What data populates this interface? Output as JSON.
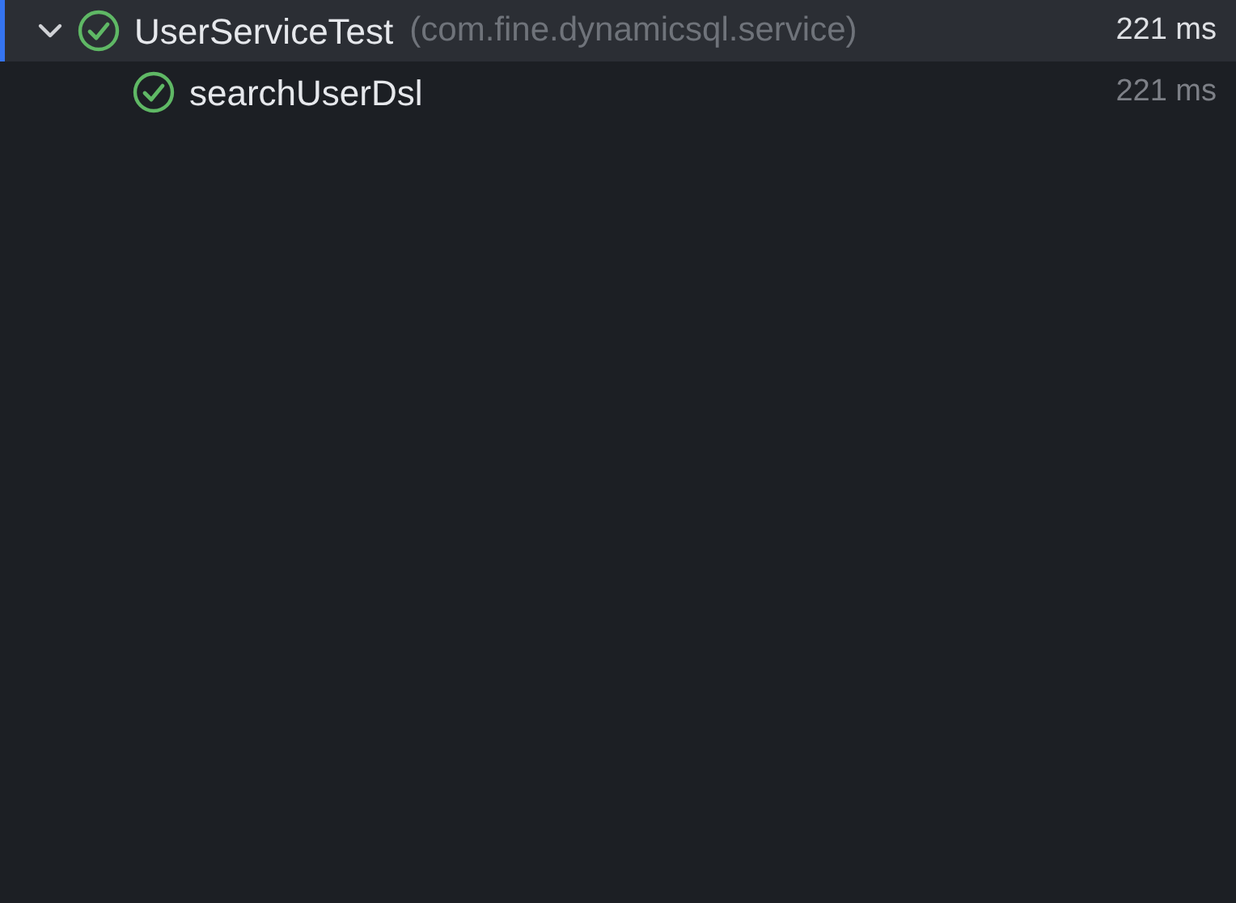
{
  "tree": [
    {
      "name": "UserServiceTest",
      "package": "(com.fine.dynamicsql.service)",
      "duration": "221 ms",
      "kind": "passed",
      "expanded": true,
      "selected": true,
      "children": [
        {
          "name": "searchUserDsl",
          "duration": "221 ms",
          "kind": "passed",
          "selected": false
        }
      ]
    }
  ]
}
